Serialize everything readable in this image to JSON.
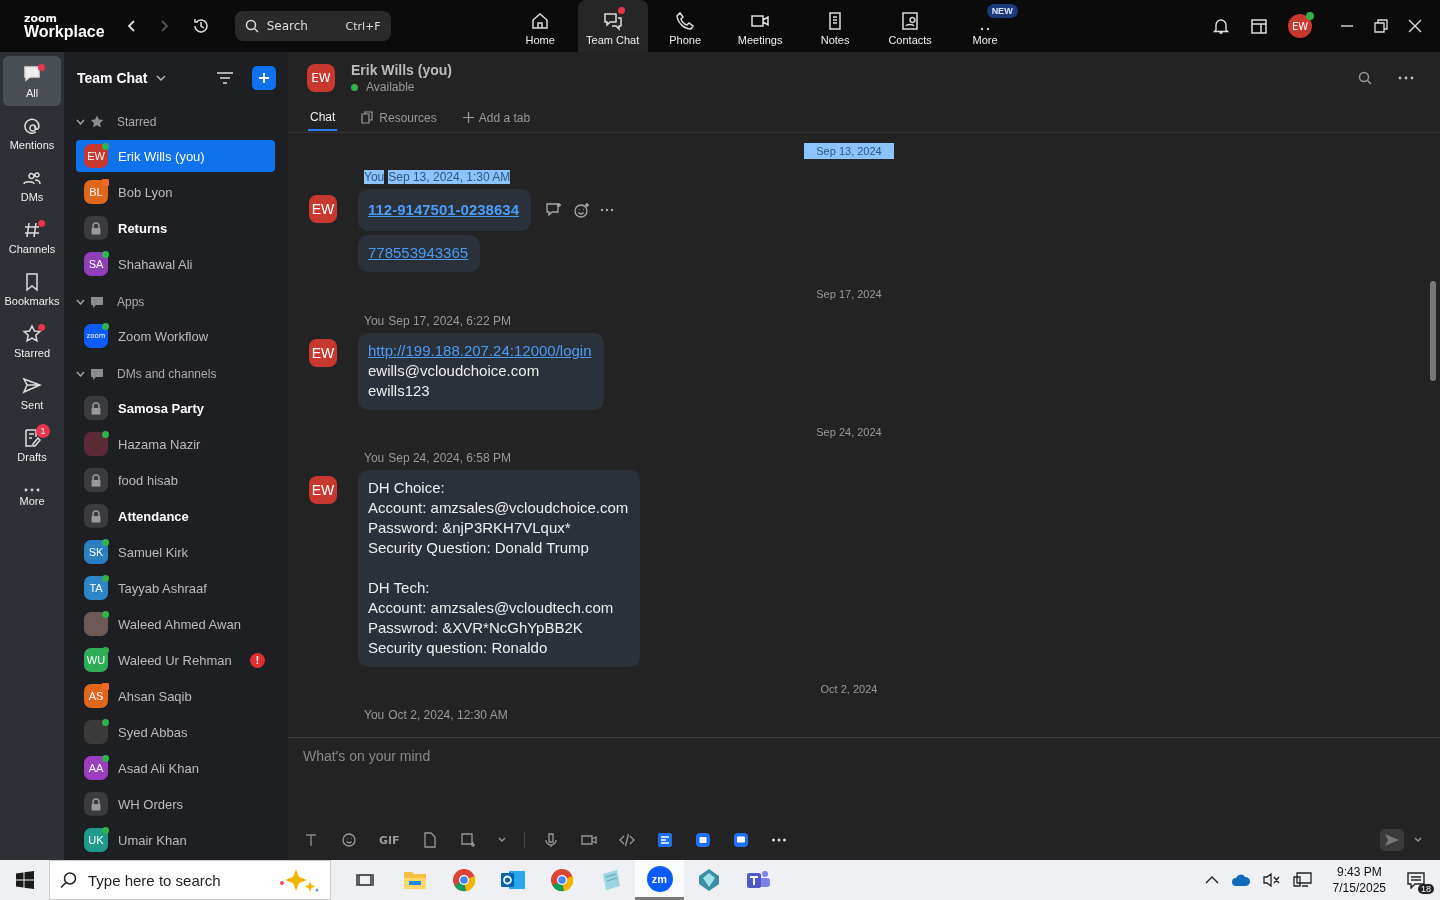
{
  "top_bar": {
    "logo_small": "zoom",
    "logo": "Workplace",
    "search": {
      "placeholder": "Search",
      "shortcut": "Ctrl+F"
    },
    "nav": [
      {
        "kind": "home",
        "label": "Home",
        "selected": false,
        "dot": false
      },
      {
        "kind": "chat",
        "label": "Team Chat",
        "selected": true,
        "dot": true
      },
      {
        "kind": "phone",
        "label": "Phone",
        "selected": false,
        "dot": false
      },
      {
        "kind": "meetings",
        "label": "Meetings",
        "selected": false,
        "dot": false
      },
      {
        "kind": "notes",
        "label": "Notes",
        "selected": false,
        "dot": false
      },
      {
        "kind": "contacts",
        "label": "Contacts",
        "selected": false,
        "dot": false
      },
      {
        "kind": "more",
        "label": "More",
        "selected": false,
        "badge": "NEW"
      }
    ],
    "avatar": "EW"
  },
  "rail": [
    {
      "kind": "all",
      "label": "All",
      "selected": true,
      "dot": true
    },
    {
      "kind": "mentions",
      "label": "Mentions",
      "selected": false,
      "dot": false
    },
    {
      "kind": "dms",
      "label": "DMs",
      "selected": false,
      "dot": false
    },
    {
      "kind": "channels",
      "label": "Channels",
      "selected": false,
      "dot": true
    },
    {
      "kind": "bookmarks",
      "label": "Bookmarks",
      "selected": false,
      "dot": false
    },
    {
      "kind": "starred",
      "label": "Starred",
      "selected": false,
      "dot": true
    },
    {
      "kind": "sent",
      "label": "Sent",
      "selected": false,
      "dot": false
    },
    {
      "kind": "drafts",
      "label": "Drafts",
      "selected": false,
      "count": "1"
    },
    {
      "kind": "more",
      "label": "More",
      "selected": false,
      "dot": false
    }
  ],
  "sidebar": {
    "title": "Team Chat",
    "sections": [
      {
        "kind": "starred",
        "title": "Starred",
        "expanded": true,
        "items": [
          {
            "kind": "person",
            "name": "Erik Wills (you)",
            "initials": "EW",
            "color": "#c8382e",
            "busy": false,
            "bold": false,
            "selected": true
          },
          {
            "kind": "person",
            "name": "Bob Lyon",
            "initials": "BL",
            "color": "#e0661a",
            "busy": true,
            "bold": false,
            "selected": false
          },
          {
            "kind": "channel",
            "name": "Returns",
            "bold": true,
            "selected": false
          },
          {
            "kind": "person",
            "name": "Shahawal Ali",
            "initials": "SA",
            "color": "#8e3fb5",
            "busy": false,
            "bold": false,
            "selected": false
          }
        ]
      },
      {
        "kind": "apps",
        "title": "Apps",
        "expanded": true,
        "items": [
          {
            "kind": "app",
            "name": "Zoom Workflow",
            "initials": "zoom",
            "color": "#0b5cff",
            "busy": false,
            "bold": false,
            "selected": false
          }
        ]
      },
      {
        "kind": "dms",
        "title": "DMs and channels",
        "expanded": true,
        "items": [
          {
            "kind": "channel",
            "name": "Samosa Party",
            "bold": true,
            "selected": false
          },
          {
            "kind": "photo",
            "name": "Hazama Nazir",
            "color": "#5a2a36",
            "busy": false,
            "bold": false,
            "selected": false
          },
          {
            "kind": "channel",
            "name": "food hisab",
            "bold": false,
            "selected": false
          },
          {
            "kind": "channel",
            "name": "Attendance",
            "bold": true,
            "selected": false
          },
          {
            "kind": "person",
            "name": "Samuel Kirk",
            "initials": "SK",
            "color": "#2d7fc1",
            "busy": false,
            "bold": false,
            "selected": false
          },
          {
            "kind": "person",
            "name": "Tayyab Ashraaf",
            "initials": "TA",
            "color": "#2d86c9",
            "busy": false,
            "bold": false,
            "selected": false
          },
          {
            "kind": "photo",
            "name": "Waleed Ahmed Awan",
            "color": "#6b5a58",
            "busy": false,
            "bold": false,
            "selected": false
          },
          {
            "kind": "person",
            "name": "Waleed Ur Rehman",
            "initials": "WU",
            "color": "#2fae5a",
            "busy": false,
            "bold": false,
            "selected": false,
            "alert": "!"
          },
          {
            "kind": "person",
            "name": "Ahsan Saqib",
            "initials": "AS",
            "color": "#e0661a",
            "busy": true,
            "bold": false,
            "selected": false
          },
          {
            "kind": "photo",
            "name": "Syed Abbas",
            "color": "#3a3a3a",
            "busy": false,
            "bold": false,
            "selected": false
          },
          {
            "kind": "person",
            "name": "Asad Ali Khan",
            "initials": "AA",
            "color": "#9b3fc0",
            "busy": false,
            "bold": false,
            "selected": false
          },
          {
            "kind": "channel",
            "name": "WH Orders",
            "bold": false,
            "selected": false
          },
          {
            "kind": "person",
            "name": "Umair Khan",
            "initials": "UK",
            "color": "#1f9c8b",
            "busy": false,
            "bold": false,
            "selected": false
          }
        ]
      }
    ]
  },
  "chat": {
    "avatar": "EW",
    "name": "Erik Wills (you)",
    "status": "Available",
    "tabs": [
      {
        "kind": "chat",
        "label": "Chat",
        "selected": true
      },
      {
        "kind": "resources",
        "label": "Resources",
        "selected": false
      },
      {
        "kind": "add",
        "label": "Add a tab",
        "selected": false
      }
    ],
    "stream": [
      {
        "kind": "date",
        "text": "Sep 13, 2024",
        "selected": true
      },
      {
        "kind": "message",
        "sender": "You",
        "time": "Sep 13, 2024, 1:30 AM",
        "selected": true,
        "avatar": "EW",
        "hover_actions": true,
        "bubbles": [
          {
            "lines": [
              {
                "text": "112-9147501-0238634",
                "link": true,
                "bold": true
              }
            ]
          },
          {
            "lines": [
              {
                "text": "778553943365",
                "link": true,
                "bold": false
              }
            ]
          }
        ]
      },
      {
        "kind": "date",
        "text": "Sep 17, 2024",
        "selected": false
      },
      {
        "kind": "message",
        "sender": "You",
        "time": "Sep 17, 2024, 6:22 PM",
        "selected": false,
        "avatar": "EW",
        "hover_actions": false,
        "bubbles": [
          {
            "lines": [
              {
                "text": "http://199.188.207.24:12000/login",
                "link": true,
                "bold": false
              },
              {
                "text": "ewills@vcloudchoice.com",
                "link": false,
                "bold": false
              },
              {
                "text": "ewills123",
                "link": false,
                "bold": false
              }
            ]
          }
        ]
      },
      {
        "kind": "date",
        "text": "Sep 24, 2024",
        "selected": false
      },
      {
        "kind": "message",
        "sender": "You",
        "time": "Sep 24, 2024, 6:58 PM",
        "selected": false,
        "avatar": "EW",
        "hover_actions": false,
        "bubbles": [
          {
            "lines": [
              {
                "text": "DH Choice:",
                "link": false,
                "bold": false
              },
              {
                "text": "Account: amzsales@vcloudchoice.com",
                "link": false,
                "bold": false
              },
              {
                "text": "Password: &njP3RKH7VLqux*",
                "link": false,
                "bold": false
              },
              {
                "text": "Security Question: Donald Trump",
                "link": false,
                "bold": false
              },
              {
                "text": "DH Tech:",
                "link": false,
                "bold": false,
                "gap_before": true
              },
              {
                "text": "Account: amzsales@vcloudtech.com",
                "link": false,
                "bold": false
              },
              {
                "text": "Passwrod: &XVR*NcGhYpBB2K",
                "link": false,
                "bold": false
              },
              {
                "text": "Security question: Ronaldo",
                "link": false,
                "bold": false
              }
            ]
          }
        ]
      },
      {
        "kind": "date",
        "text": "Oct 2, 2024",
        "selected": false
      },
      {
        "kind": "message",
        "sender": "You",
        "time": "Oct 2, 2024, 12:30 AM",
        "selected": false
      }
    ]
  },
  "composer": {
    "placeholder": "What's on your mind",
    "tools": [
      {
        "kind": "format"
      },
      {
        "kind": "emoji"
      },
      {
        "kind": "gif",
        "label": "GIF"
      },
      {
        "kind": "file"
      },
      {
        "kind": "screenshot"
      },
      {
        "kind": "caret"
      },
      {
        "kind": "divider"
      },
      {
        "kind": "mic"
      },
      {
        "kind": "video"
      },
      {
        "kind": "code"
      },
      {
        "kind": "app1"
      },
      {
        "kind": "app2"
      },
      {
        "kind": "app3"
      },
      {
        "kind": "more"
      }
    ]
  },
  "taskbar": {
    "search": {
      "placeholder": "Type here to search"
    },
    "apps": [
      {
        "kind": "taskview",
        "selected": false
      },
      {
        "kind": "explorer",
        "selected": false
      },
      {
        "kind": "chrome",
        "selected": false
      },
      {
        "kind": "outlook",
        "selected": false
      },
      {
        "kind": "chrome",
        "selected": false
      },
      {
        "kind": "notepad",
        "selected": false
      },
      {
        "kind": "zoom",
        "label": "zm",
        "selected": true
      },
      {
        "kind": "gem",
        "selected": false
      },
      {
        "kind": "teams",
        "selected": false
      }
    ],
    "time": "9:43 PM",
    "date": "7/15/2025",
    "notifications": "18"
  }
}
